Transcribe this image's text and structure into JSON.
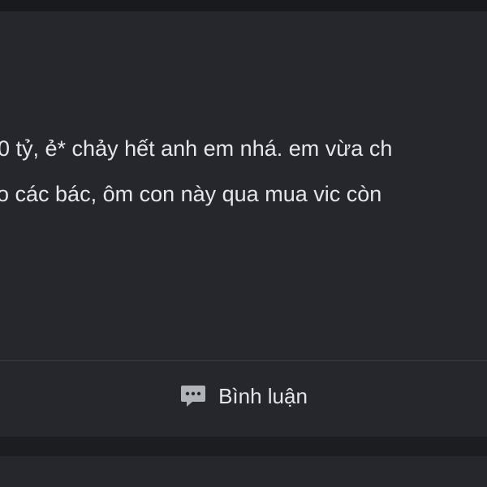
{
  "post": {
    "text_lines": [
      "0 tỷ, ẻ* chảy hết anh em nhá. em vừa ch",
      "o các bác, ôm con này qua mua vic còn"
    ]
  },
  "actions": {
    "comment_label": "Bình luận",
    "comment_icon": "comment-bubble-icon"
  },
  "colors": {
    "background": "#191a1e",
    "card": "#25272d",
    "text": "#e4e6eb",
    "icon": "#b0b3b8",
    "divider": "#3a3c42"
  }
}
